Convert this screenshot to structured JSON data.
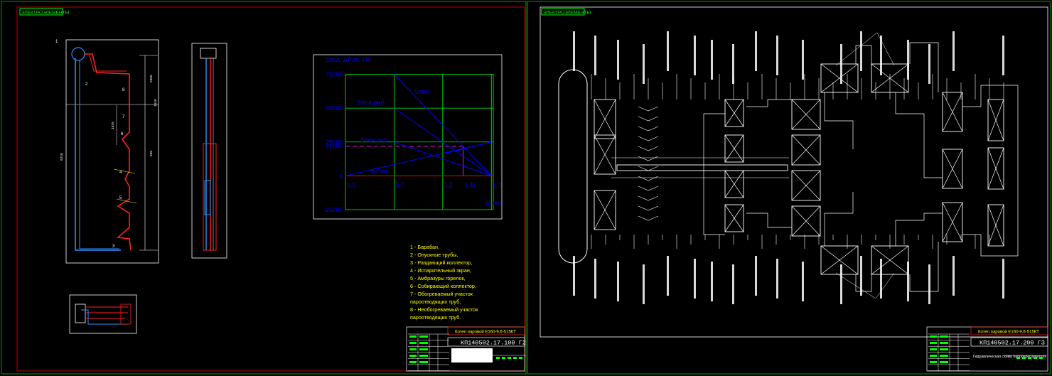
{
  "sheet1": {
    "tag": "ЭЛЕКТРОЭЛЕМЕНТЫ",
    "callouts": [
      "1",
      "2",
      "3",
      "4",
      "5",
      "6",
      "7",
      "8"
    ],
    "dims": [
      "5000",
      "4510",
      "1835",
      "900",
      "9210"
    ],
    "chart_data": {
      "type": "line",
      "ylabel": "Sпол, ΔPоп, Па",
      "x_ticks": [
        "0,2",
        "0,7",
        "1,2",
        "1,41",
        "1,7"
      ],
      "x_axis_label": "W, м/с",
      "y_ticks": [
        "75000",
        "50000",
        "25000",
        "21900",
        "0",
        "-25000"
      ],
      "series_labels": [
        "Sпол",
        "Sпол.раб",
        "Sпол.экр",
        "ΔPоп"
      ],
      "series": [
        {
          "name": "Sпол",
          "x": [
            0.7,
            1.7
          ],
          "y": [
            75000,
            0
          ]
        },
        {
          "name": "Sпол.раб",
          "x": [
            0.7,
            1.7
          ],
          "y": [
            50000,
            0
          ]
        },
        {
          "name": "Sпол.экр",
          "x": [
            0.7,
            1.7
          ],
          "y": [
            25000,
            0
          ]
        },
        {
          "name": "ΔPоп",
          "x": [
            0.2,
            1.7
          ],
          "y": [
            0,
            25000
          ]
        }
      ],
      "annotations": [
        {
          "label": "21900",
          "y": 21900,
          "x": 1.41
        }
      ],
      "ylim": [
        -25000,
        80000
      ],
      "xlim": [
        0.2,
        1.72
      ],
      "grid": true
    },
    "legend": [
      "1 - Барабан,",
      "2 - Опускные трубы,",
      "3 - Раздающий коллектор,",
      "4 - Испарительный экран,",
      "5 - Амбразуры горелок,",
      "6 - Собирающий коллектор,",
      "7 - Обогреваемый участок",
      "пароотводящих труб,",
      "8 - Необогреваемый участок",
      "пароотводящих труб."
    ],
    "stamp_title": "Котел паровой Е160-9,6-515КТ",
    "stamp_code": "КП140502.17.100 Г2"
  },
  "sheet2": {
    "tag": "ЭЛЕКТРОЭЛЕМЕНТЫ",
    "stamp_title": "Котел паровой Е160-9,6-515КТ",
    "stamp_code": "КП140502.17.200 ГЗ",
    "stamp_caption": "Гидравлическая схема пароперегревателя"
  },
  "colors": {
    "frame": "#00a000",
    "border": "#c00000",
    "white": "#ffffff",
    "chart_text": "#0000ff",
    "grid": "#00ff00",
    "line_red": "#ff0000",
    "line_blue": "#3090ff",
    "yellow": "#ffff00",
    "magenta": "#ff00ff"
  }
}
